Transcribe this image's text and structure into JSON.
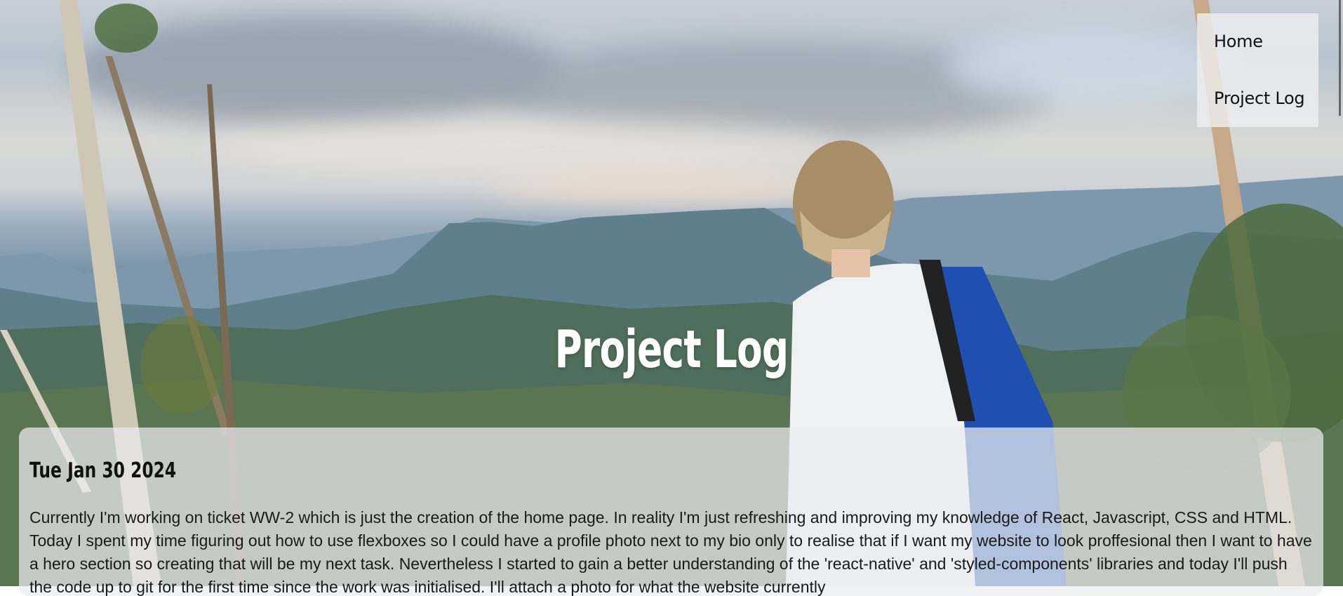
{
  "nav": {
    "items": [
      {
        "label": "Home"
      },
      {
        "label": "Project Log"
      }
    ]
  },
  "hero": {
    "title": "Project Log"
  },
  "entry": {
    "date": "Tue Jan 30 2024",
    "body": "Currently I'm working on ticket WW-2 which is just the creation of the home page. In reality I'm just refreshing and improving my knowledge of React, Javascript, CSS and HTML. Today I spent my time figuring out how to use flexboxes so I could have a profile photo next to my bio only to realise that if I want my website to look proffesional then I want to have a hero section so creating that will be my next task. Nevertheless I started to gain a better understanding of the 'react-native' and 'styled-components' libraries and today I'll push the code up to git for the first time since the work was initialised. I'll attach a photo for what the website currently"
  },
  "colors": {
    "nav_bg": "#f0f0f2",
    "title": "#ffffff",
    "card_bg": "#ebedf0",
    "text": "#111111"
  }
}
